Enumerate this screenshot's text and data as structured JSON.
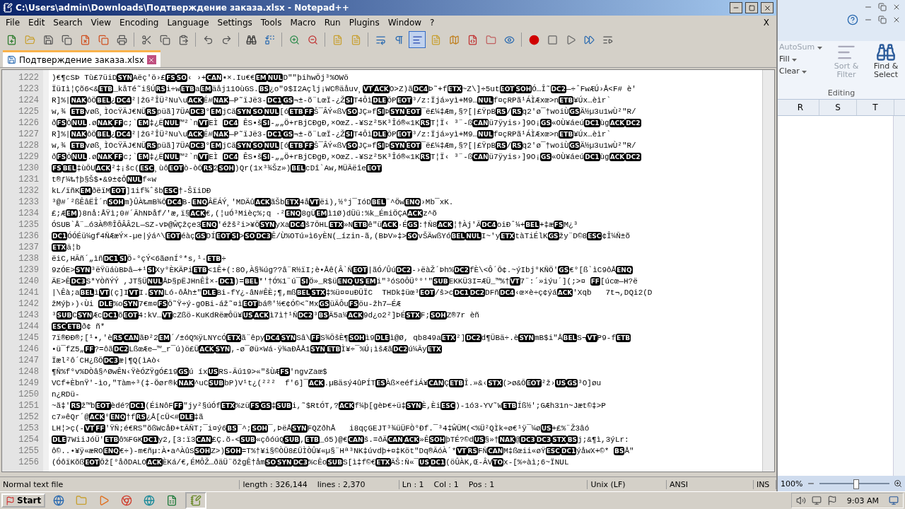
{
  "window": {
    "title": "C:\\Users\\admin\\Downloads\\Подтверждение заказа.xlsx - Notepad++",
    "close_doc": "X"
  },
  "menu": [
    "File",
    "Edit",
    "Search",
    "View",
    "Encoding",
    "Language",
    "Settings",
    "Tools",
    "Macro",
    "Run",
    "Plugins",
    "Window",
    "?"
  ],
  "tabs": [
    {
      "label": "Подтверждение заказа.xlsx",
      "selected": true
    }
  ],
  "editor": {
    "line_numbers": [
      "1222",
      "1223",
      "1224",
      "1225",
      "1226",
      "1227",
      "1228",
      "1229",
      "1230",
      "1231",
      "1232",
      "1233",
      "1234",
      "1235",
      "1236",
      "1237",
      "1238",
      "1239",
      "1240",
      "1241",
      "1242",
      "1243",
      "1244",
      "1245",
      "1246",
      "1247",
      "1248",
      "1249",
      "1250",
      "1251",
      "1252",
      "1253",
      "1254",
      "1255",
      "1256"
    ],
    "lines": [
      [
        ")€¶cSÞ Tù£7üiD",
        {
          "control": "SYN"
        },
        "Aëç'ö›£",
        {
          "control": "FS"
        },
        {
          "control": "SO"
        },
        "‹ ›+",
        {
          "control": "CAN"
        },
        "▪×.Iu€€",
        {
          "control": "EM"
        },
        {
          "control": "NUL"
        },
        "D\"″þihwÕj³%OWö"
      ],
      [
        "ÏüIì¦Çõ6<&",
        {
          "control": "ETB"
        },
        "_kåTé˜i§Ú",
        {
          "control": "RS"
        },
        "i÷w",
        {
          "control": "ETB"
        },
        "a",
        {
          "control": "EM"
        },
        "äåj11OùGS.",
        {
          "control": "BS"
        },
        "¿o″9$I2Açlj¡WC®äåuv¸",
        {
          "control": "VT"
        },
        {
          "control": "ACK"
        },
        "O>Z)ã",
        {
          "control": "DC4"
        },
        "Þ˜+f",
        {
          "control": "ETX"
        },
        "~Z\\]÷5ut",
        {
          "control": "EOT"
        },
        {
          "control": "SOH"
        },
        "Ó…Î˜",
        {
          "control": "DC2"
        },
        "—÷ˆFwÆÚ›Å<F# è'"
      ],
      [
        "R]%|",
        {
          "control": "NAK"
        },
        "ôÖ",
        {
          "control": "BEL"
        },
        "¿",
        {
          "control": "DC4"
        },
        "²|žG²ÎÜ²Nu\\u",
        {
          "control": "ACK"
        },
        "É#",
        {
          "control": "NAK"
        },
        "—P˜ïJë3-",
        {
          "control": "DC1"
        },
        {
          "control": "GS"
        },
        "¬±-õ¨LœÏ-¿Ž",
        {
          "control": "SI"
        },
        "T4Ôì",
        {
          "control": "DLE"
        },
        "ÕP",
        {
          "control": "EOT"
        },
        "³/z:Ïjá»yì+M9…",
        {
          "control": "NUL"
        },
        "f¤çRPã¹ÁÌÆxœ>n",
        {
          "control": "ETB"
        },
        "¥Úx…èìr`"
      ],
      [
        "w,¾ ",
        {
          "control": "ETB"
        },
        "vøß¸ÌOcŸÄJ€NÜ",
        {
          "control": "RS"
        },
        "püã]7ÜA",
        {
          "control": "DC3"
        },
        "°",
        {
          "control": "EM"
        },
        "jCä",
        {
          "control": "SYN"
        },
        {
          "control": "SO"
        },
        {
          "control": "NUL"
        },
        "[ó",
        {
          "control": "ETB"
        },
        {
          "control": "FF"
        },
        "Š¯ÂÝ«ßV",
        {
          "control": "SO"
        },
        "JÇ»f",
        {
          "control": "SI"
        },
        "Þ",
        {
          "control": "SYN"
        },
        {
          "control": "EOT"
        },
        "¯ë£¼‡Æm,§?[|£ŸpB",
        {
          "control": "RS"
        },
        "/",
        {
          "control": "RS"
        },
        "q2'ø¯†woiÙ",
        {
          "control": "GS"
        },
        "Ä½µ3u1wÙ²\"R/"
      ],
      [
        "ð",
        {
          "control": "FS"
        },
        "Õ",
        {
          "control": "NUL"
        },
        ".ø",
        {
          "control": "NAK"
        },
        {
          "control": "FF"
        },
        "c;`",
        {
          "control": "EM"
        },
        "‡¿Ë",
        {
          "control": "NUL"
        },
        "™²`n",
        {
          "control": "VT"
        },
        "EÌ ",
        {
          "control": "DC4"
        },
        " ÊS▪š",
        {
          "control": "SI"
        },
        "-„„Ö+rBjCÐgÐ,×OœZ.-¥Sz²5K³Îó®«1K",
        {
          "control": "RS"
        },
        "T¦Ï‹ ³¨-ß",
        {
          "control": "CAN"
        },
        "ü7ÿyis›]9O¡",
        {
          "control": "GS"
        },
        "«OÙ¥áeú",
        {
          "control": "DC1"
        },
        "ùg",
        {
          "control": "ACK"
        },
        {
          "control": "DC2"
        }
      ],
      [
        "R]%|",
        {
          "control": "NAK"
        },
        "ôÖ",
        {
          "control": "BEL"
        },
        "¿",
        {
          "control": "DC4"
        },
        "²|žG²ÎÜ²Nu\\u",
        {
          "control": "ACK"
        },
        "É#",
        {
          "control": "NAK"
        },
        "—P˜ïJë3-",
        {
          "control": "DC1"
        },
        {
          "control": "GS"
        },
        "¬±-õ¨LœÏ-¿Ž",
        {
          "control": "SI"
        },
        "T4Ôì",
        {
          "control": "DLE"
        },
        "ÕP",
        {
          "control": "EOT"
        },
        "³/z:Ïjá»yì+M9…",
        {
          "control": "NUL"
        },
        "f¤çRPã¹ÁÌÆxœ>n",
        {
          "control": "ETB"
        },
        "¥Úx…èìr`"
      ],
      [
        "w,¾ ",
        {
          "control": "ETB"
        },
        "vøß¸ÌOcŸÄJ€NÜ",
        {
          "control": "RS"
        },
        "püã]7ÜA",
        {
          "control": "DC3"
        },
        "°",
        {
          "control": "EM"
        },
        "jCä",
        {
          "control": "SYN"
        },
        {
          "control": "SO"
        },
        {
          "control": "NUL"
        },
        "[ó",
        {
          "control": "ETB"
        },
        {
          "control": "FF"
        },
        "Š¯ÂÝ«ßV",
        {
          "control": "SO"
        },
        "JÇ»f",
        {
          "control": "SI"
        },
        "Þ",
        {
          "control": "SYN"
        },
        {
          "control": "EOT"
        },
        "¯ë£¼‡Æm,§?[|£ŸpB",
        {
          "control": "RS"
        },
        "/",
        {
          "control": "RS"
        },
        "q2'ø¯†woiÙ",
        {
          "control": "GS"
        },
        "Ä½µ3u1wÙ²\"R/"
      ],
      [
        "ð",
        {
          "control": "FS"
        },
        "Õ",
        {
          "control": "NUL"
        },
        ".ø",
        {
          "control": "NAK"
        },
        {
          "control": "FF"
        },
        "c;`",
        {
          "control": "EM"
        },
        "‡¿Ë",
        {
          "control": "NUL"
        },
        "™²`n",
        {
          "control": "VT"
        },
        "EÌ ",
        {
          "control": "DC4"
        },
        " ÊS▪š",
        {
          "control": "SI"
        },
        "-„„Ö+rBjCÐgÐ,×OœZ.-¥Sz²5K³Îó®«1K",
        {
          "control": "RS"
        },
        "T¦Ï‹ ³¨-ß",
        {
          "control": "CAN"
        },
        "ü7ÿyis›]9O¡",
        {
          "control": "GS"
        },
        "«OÙ¥áeú",
        {
          "control": "DC1"
        },
        "ùg",
        {
          "control": "ACK"
        },
        {
          "control": "DC2"
        }
      ],
      [
        {
          "control": "FS"
        },
        {
          "control": "BEL"
        },
        "‡ùÕU",
        {
          "control": "ACK"
        },
        "²‡¡šc(",
        {
          "control": "ESC"
        },
        "¸ùô",
        {
          "control": "EOT"
        },
        "ò-òŐ",
        {
          "control": "RS"
        },
        "2",
        {
          "control": "SOH"
        },
        ")Qr(1x³¾Šz»)",
        {
          "control": "BEL"
        },
        "cDî`Aw,MÜÃëîe",
        {
          "control": "EOT"
        }
      ],
      [
        "t®ƒ¼‰†þ§Š$▪&9±¢Ô",
        {
          "control": "NUL"
        },
        "f«w"
      ],
      [
        "kL/ïñK",
        {
          "control": "EM"
        },
        "ðëïM",
        {
          "control": "EOT"
        },
        "]1if¾ˆšb",
        {
          "control": "ESC"
        },
        "†-ŠïiDÐ"
      ],
      [
        "³@#´²ßÊâËÎ´n",
        {
          "control": "SOH"
        },
        "m}ÛÀ‰mB¾Õ",
        {
          "control": "DC4"
        },
        "B-",
        {
          "control": "ENQ"
        },
        "ÂËÁÝ¸'MDÄû",
        {
          "control": "ACK"
        },
        "ãŠb",
        {
          "control": "ETX"
        },
        "4å",
        {
          "control": "VT"
        },
        "ëi),½°j¯IóD",
        {
          "control": "BEL"
        },
        "¨^Öw",
        {
          "control": "ENQ"
        },
        "›Mb¯xK."
      ],
      [
        "£;Æ",
        {
          "control": "EM"
        },
        ")8nå:ÅŸì;0#´ÃhNÞåf/'æ,ï§",
        {
          "control": "ACK"
        },
        "€,(¦uÓ³Mièç%;q ·²",
        {
          "control": "ENQ"
        },
        "8gÜ",
        {
          "control": "EM"
        },
        "ì1Ø)dÜü:%k_ÉmiÖÇA",
        {
          "control": "ACK"
        },
        "z^õ"
      ],
      [
        "ÓSUB`Å¨…ó3À®®ÎÔÂÂ2L—SZ-vÞ@ŴÇžçe3",
        {
          "control": "ENQ"
        },
        "'éžš²i>¥Ö",
        {
          "control": "SYN"
        },
        "yXa",
        {
          "control": "DC4"
        },
        "š7ÕHL",
        {
          "control": "ETX"
        },
        "»N",
        {
          "control": "ETB"
        },
        "ê\"ü",
        {
          "control": "ACK"
        },
        "·É",
        {
          "control": "GS"
        },
        ":†Ñ8",
        {
          "control": "ACK"
        },
        "¦†Àj'Ã",
        {
          "control": "DC4"
        },
        "oiÐˆ¼+",
        {
          "control": "BEL"
        },
        "+‡æ",
        {
          "control": "FS"
        },
        "M¿³"
      ],
      [
        {
          "control": "DC1"
        },
        "ÓÓÉü¼gf4ÑÆæÝ×-µe|ýá^\\",
        {
          "control": "EOT"
        },
        "éàç",
        {
          "control": "GS"
        },
        "DÍ",
        {
          "control": "EOT"
        },
        {
          "control": "SI"
        },
        ">",
        {
          "control": "SO"
        },
        {
          "control": "DC3"
        },
        "Ê/Ù%OTú»ì6yÈN(_ízin-ã,(BÞV»‡>",
        {
          "control": "SO"
        },
        "vŠÄwßYó",
        {
          "control": "BEL"
        },
        {
          "control": "NUL"
        },
        "I~'y",
        {
          "control": "ETX"
        },
        "tàTiÉlK",
        {
          "control": "GS"
        },
        "žy¨D©8",
        {
          "control": "ESC"
        },
        "¢Î¼Ñ±õ"
      ],
      [
        {
          "control": "ETX"
        },
        "ä¦b"
      ],
      [
        "ëiC,HÃñ´„ìñ",
        {
          "control": "DC1"
        },
        {
          "control": "SI"
        },
        "Ö-°çÝ<6ãønÍ°*s,¹-",
        {
          "control": "ETB"
        },
        "÷"
      ],
      [
        "9zÓE>",
        {
          "control": "SYN"
        },
        "³ëŸüáùBÞâ—+¹",
        {
          "control": "SI"
        },
        "Xy°ÈKÄPi",
        {
          "control": "ETB"
        },
        "<1Ê+(:8O,À§¾úg??â¨R½ïI;è•Åê(Â`Ñ",
        {
          "control": "EOT"
        },
        "|ãÓ/Ûú",
        {
          "control": "DC2"
        },
        "-›ëàŽ´Þh%",
        {
          "control": "DC2"
        },
        "fÈ\\<Ô´Õ¢.~ýIbj°KÑÖ'",
        {
          "control": "GS"
        },
        "€°[ß`ìC9ôÅ",
        {
          "control": "ENQ"
        }
      ],
      [
        "ÄE>Ê",
        {
          "control": "DC3"
        },
        "S*YÒñÝÝ ,JT§Ü",
        {
          "control": "NUL"
        },
        "ÅÞ§pËJHnÊÎ×-",
        {
          "control": "DC1"
        },
        ")=",
        {
          "control": "BEL"
        },
        "*'†Ó%1¨ú¯",
        {
          "control": "SI"
        },
        "Ö»_R$ü",
        {
          "control": "ENQ"
        },
        {
          "control": "US"
        },
        {
          "control": "EM"
        },
        "i\"³óSOÔÜ°°'\"",
        {
          "control": "SUB"
        },
        "EKKÜ3I=ÆÜ_™%†",
        {
          "control": "VT"
        },
        "7¨:´»iýu´](;>¤ ",
        {
          "control": "FF"
        },
        "[úcœ—H?ë"
      ],
      [
        "|\\Êà;a",
        {
          "control": "BEL"
        },
        "ì",
        {
          "control": "VT"
        },
        "(ç]I",
        {
          "control": "VT"
        },
        "I.",
        {
          "control": "SYN"
        },
        "Ló-ôÅh±\"",
        {
          "control": "DLE"
        },
        "Bi-fY¿-âN#ÊÈ;¶,mß",
        {
          "control": "BEL"
        },
        {
          "control": "STX"
        },
        "‡%ü¤¤uÐÜÏC  THDk‡üœ³",
        {
          "control": "EOT"
        },
        "/š>c",
        {
          "control": "DC1"
        },
        {
          "control": "DC2"
        },
        "DFñ",
        {
          "control": "DC4"
        },
        "‹œ×è÷ç¢ýá",
        {
          "control": "ACK"
        },
        "'Xqb   7t¬,DQi2(D"
      ],
      [
        "žMýþ›)‹Ùi ",
        {
          "control": "DLE"
        },
        "%o",
        {
          "control": "SYN"
        },
        "7€m¤",
        {
          "control": "FS"
        },
        "Ö˜Ÿ÷ý-gOBi-áž˜¤ì",
        {
          "control": "EOT"
        },
        "bá®'½€¢Ó©<˜Mx",
        {
          "control": "GS"
        },
        "üÄÔu",
        {
          "control": "FS"
        },
        "öu-žh7—ÉÆ"
      ],
      [
        "³",
        {
          "control": "SUB"
        },
        "C",
        {
          "control": "SYN"
        },
        "Æc",
        {
          "control": "DC1"
        },
        "õ",
        {
          "control": "EOT"
        },
        "4:kV…",
        {
          "control": "VT"
        },
        "cZßö-KuKdRëæÔü¥",
        {
          "control": "US"
        },
        {
          "control": "ACK"
        },
        "ì7ì†¹Ñ",
        {
          "control": "DC2"
        },
        "³",
        {
          "control": "BS"
        },
        "Ä5a¼",
        {
          "control": "ACK"
        },
        "9d¿o2²]ÞÉ",
        {
          "control": "STX"
        },
        "F;",
        {
          "control": "SOH"
        },
        "Z®7r èñ"
      ],
      [
        {
          "control": "ESC"
        },
        {
          "control": "ETB"
        },
        "ð¢ ñ*"
      ],
      [
        "7ï®ÐÐ®;[¹•,'è",
        {
          "control": "RS"
        },
        {
          "control": "CAN"
        },
        "ãÐ²2",
        {
          "control": "EM"
        },
        "´/±óQ%ÿLNYcÓ",
        {
          "control": "ETX"
        },
        "ã¨êpy",
        {
          "control": "DC4"
        },
        {
          "control": "SYN"
        },
        "Sâ\\",
        {
          "control": "FF"
        },
        "S¾ÕšÈ¶",
        {
          "control": "SOH"
        },
        "ì9",
        {
          "control": "DLE"
        },
        "ì@Ø, qb849a",
        {
          "control": "ETX"
        },
        "²]",
        {
          "control": "DC2"
        },
        "d¶ÜBä÷.è",
        {
          "control": "SYN"
        },
        "mB$i\"Å",
        {
          "control": "BEL"
        },
        "S¬",
        {
          "control": "VT"
        },
        "P9-f",
        {
          "control": "ETB"
        }
      ],
      [
        "•ü¯fZ5„",
        {
          "control": "FF"
        },
        "?=ôã",
        {
          "control": "DC2"
        },
        "LßœÆe—™_r¯ú)ö£Ü",
        {
          "control": "ACK"
        },
        {
          "control": "SYN"
        },
        ",-ø¯Øü×Wá·ÿ¾aÐÅÅ1",
        {
          "control": "SYN"
        },
        {
          "control": "ETB"
        },
        "Ì¥÷¯%Ú¡ìšÆã",
        {
          "control": "DC2"
        },
        "ú¼Ãy",
        {
          "control": "ETX"
        }
      ],
      [
        "Ïæl²ô´CH¿ßÕ",
        {
          "control": "DC3"
        },
        "æ|¶Q(ìAò‹"
      ],
      [
        "¶Ñ%f°v%DÒâ§^ØwÊN‹ŸèÓZŸgÓ£19",
        {
          "control": "GS"
        },
        "ú íx",
        {
          "control": "US"
        },
        "RS-Ãú19>«\"šÙÆ",
        {
          "control": "FS"
        },
        "'ngvZaœ$"
      ],
      [
        "VCf+ÈbnŸ'-ìo,\"Tàm÷³(‡-Öør®k",
        {
          "control": "NAK"
        },
        "^uC",
        {
          "control": "SUB"
        },
        "bP)V¹t¿(²²²  f'6]¯",
        {
          "control": "ACK"
        },
        ".µBäsý4ûPÍT",
        {
          "control": "ES"
        },
        "Àß×eéfiÁ¥",
        {
          "control": "CAN"
        },
        "Ç",
        {
          "control": "ETB"
        },
        "Î.»&‹",
        {
          "control": "STX"
        },
        "(>ø&Õ",
        {
          "control": "EOT"
        },
        "²ž›",
        {
          "control": "US"
        },
        {
          "control": "GS"
        },
        "³O]øu"
      ],
      [
        "n¿RDü-"
      ],
      [
        "~ã‡'",
        {
          "control": "RS"
        },
        "ž™b",
        {
          "control": "EOT"
        },
        "èdé?",
        {
          "control": "DC1"
        },
        "(ÉiNôF",
        {
          "control": "FF"
        },
        "\"jy²§úÓf",
        {
          "control": "ETX"
        },
        "%zü",
        {
          "control": "FS"
        },
        {
          "control": "GS"
        },
        "‡",
        {
          "control": "SUB"
        },
        "i,˜$RtÓT,?",
        {
          "control": "ACK"
        },
        "f¼þ[gèÞ€÷ü‡",
        {
          "control": "SYN"
        },
        "È,Èi",
        {
          "control": "ESC"
        },
        ")-1ó3-YV˜W",
        {
          "control": "ETB"
        },
        "Íß½';GÆh31n~Jæt©‡>P"
      ],
      [
        "c7»êQr´@",
        {
          "control": "ACK"
        },
        "°",
        {
          "control": "ENQ"
        },
        "†f",
        {
          "control": "RS"
        },
        "¿Å[cÜ<#",
        {
          "control": "DLE"
        },
        "‡ã"
      ],
      [
        "LH¦>ç(-",
        {
          "control": "VT"
        },
        {
          "control": "FF"
        },
        "'ŸÑ;é€RS\"õßWcåÐ+tÃÑT;¯i¤ý6",
        {
          "control": "BS"
        },
        "¯^;",
        {
          "control": "SOH"
        },
        "¯,ÞëÅ",
        {
          "control": "SYN"
        },
        "FQZðhÅ   i8qçGEJT³¾üÜFÒ°Ðf.¯³4‡ŴÜM(<%Ü²QÌk÷ø€¹ÿ¯¼ø",
        {
          "control": "US"
        },
        "+£%¨Ž3âó"
      ],
      [
        {
          "control": "DLE"
        },
        "7WiiJóÜ'",
        {
          "control": "ETB"
        },
        "ô%FGK",
        {
          "control": "DC1"
        },
        "y2,[3:ï3",
        {
          "control": "CAN"
        },
        "£Ç.õ-<",
        {
          "control": "SUB"
        },
        "«çôóúQ",
        {
          "control": "SUB"
        },
        ",",
        {
          "control": "ETB"
        },
        "_ó5)@€",
        {
          "control": "CAN"
        },
        "š.=ðÄ",
        {
          "control": "CAN"
        },
        {
          "control": "ACK"
        },
        "»Ê",
        {
          "control": "SOH"
        },
        "þTÉ?©d",
        {
          "control": "US"
        },
        "§»†",
        {
          "control": "NAK"
        },
        "@",
        {
          "control": "DC3"
        },
        {
          "control": "DC3"
        },
        {
          "control": "STX"
        },
        {
          "control": "BS"
        },
        "j;&¶ì,3ýLr:"
      ],
      [
        "ô©..•¥ÿ«æRO",
        {
          "control": "ENQ"
        },
        "€÷)-m€ñµ:À•a^ÀûS",
        {
          "control": "SOH"
        },
        "Z>)",
        {
          "control": "SOH"
        },
        "=T%†¥i§©ÒÜ8£ÜÌÒÛ¥«µ§¨Hª³NK‡úvdþ+¤‡Köt\"Dq®ÃóÀ´*",
        {
          "control": "VT"
        },
        {
          "control": "RS"
        },
        "FÑ",
        {
          "control": "CAN"
        },
        "M‡ßœii«øŸ",
        {
          "control": "ESC"
        },
        {
          "control": "DC1"
        },
        "ýåwX+©* ",
        {
          "control": "BS"
        },
        "Å\""
      ],
      [
        "(ÓôïKõß",
        {
          "control": "EOT"
        },
        "Õž[°åðDALO",
        {
          "control": "ACK"
        },
        "ÈKá/€,ÉMÔŽ…ðäÜ¨õžgÊ†åm",
        {
          "control": "SO"
        },
        {
          "control": "SYN"
        },
        {
          "control": "DC3"
        },
        "%cÊo",
        {
          "control": "SUB"
        },
        "S[ì‡f©€",
        {
          "control": "ETX"
        },
        "ÄŠ:Ñ«¯",
        {
          "control": "US"
        },
        {
          "control": "DC1"
        },
        "(öÛÀK,Œ-ÂV",
        {
          "control": "TO"
        },
        "x-[%÷àì;6~ÏNUL"
      ]
    ]
  },
  "status": {
    "type": "Normal text file",
    "length": "length : 326,144",
    "lines": "lines : 2,370",
    "ln": "Ln : 1",
    "col": "Col : 1",
    "pos": "Pos : 1",
    "eol": "Unix (LF)",
    "encoding": "ANSI",
    "mode": "INS"
  },
  "excel": {
    "editing": [
      {
        "label": "AutoSum",
        "disabled": true
      },
      {
        "label": "Fill",
        "disabled": false
      },
      {
        "label": "Clear",
        "disabled": false
      }
    ],
    "sort": "Sort & Filter",
    "find": "Find & Select",
    "group": "Editing",
    "columns": [
      "R",
      "S",
      "T"
    ],
    "zoom": "100%"
  },
  "taskbar": {
    "start": "Start",
    "time": "9:03 AM"
  }
}
